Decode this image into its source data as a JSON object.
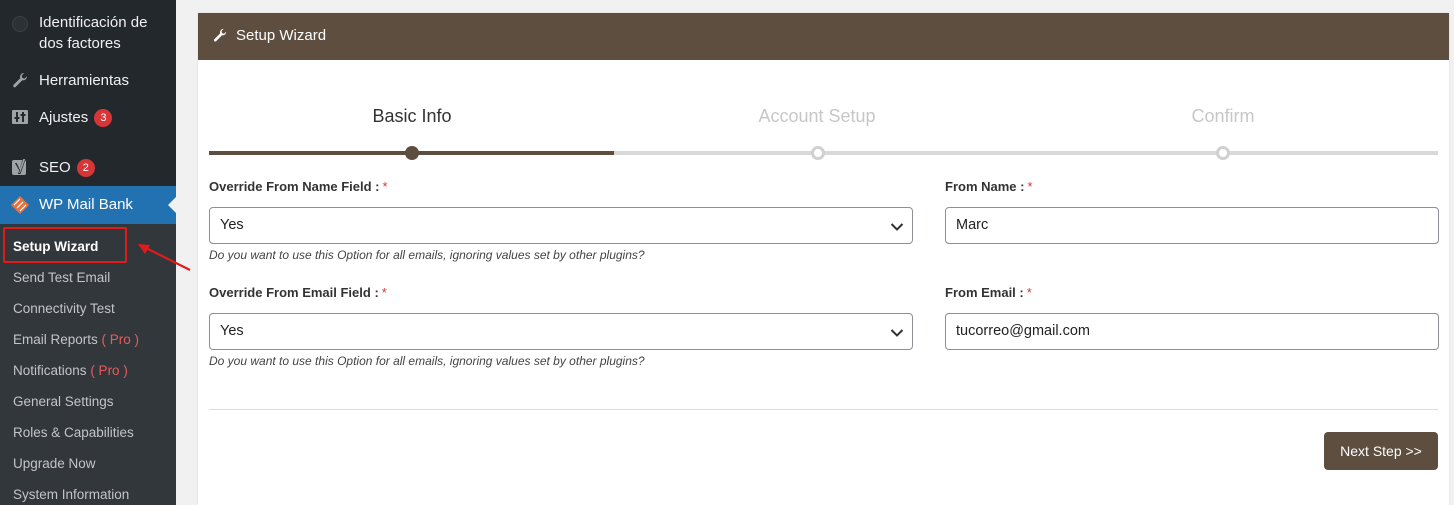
{
  "sidebar": {
    "items": [
      {
        "label_line1": "Identificación de",
        "label_line2": "dos factores",
        "icon": "two-factor-icon"
      },
      {
        "label": "Herramientas",
        "icon": "wrench-icon"
      },
      {
        "label": "Ajustes",
        "badge": "3",
        "icon": "settings-sliders-icon"
      },
      {
        "label": "SEO",
        "badge": "2",
        "icon": "yoast-seo-icon"
      },
      {
        "label": "WP Mail Bank",
        "icon": "mail-bank-icon",
        "active": true
      }
    ],
    "submenu": [
      {
        "label": "Setup Wizard",
        "active": true
      },
      {
        "label": "Send Test Email"
      },
      {
        "label": "Connectivity Test"
      },
      {
        "label": "Email Reports",
        "pro": "( Pro )"
      },
      {
        "label": "Notifications",
        "pro": "( Pro )"
      },
      {
        "label": "General Settings"
      },
      {
        "label": "Roles & Capabilities"
      },
      {
        "label": "Upgrade Now"
      },
      {
        "label": "System Information"
      }
    ]
  },
  "panel": {
    "title": "Setup Wizard",
    "header_icon": "wrench-icon",
    "header_color": "#5d4e3f"
  },
  "steps": [
    {
      "label": "Basic Info",
      "state": "active"
    },
    {
      "label": "Account Setup",
      "state": "pending"
    },
    {
      "label": "Confirm",
      "state": "pending"
    }
  ],
  "form": {
    "override_name": {
      "label": "Override From Name Field :",
      "required_mark": "*",
      "value": "Yes",
      "help": "Do you want to use this Option for all emails, ignoring values set by other plugins?"
    },
    "from_name": {
      "label": "From Name :",
      "required_mark": "*",
      "value": "Marc"
    },
    "override_email": {
      "label": "Override From Email Field :",
      "required_mark": "*",
      "value": "Yes",
      "help": "Do you want to use this Option for all emails, ignoring values set by other plugins?"
    },
    "from_email": {
      "label": "From Email :",
      "required_mark": "*",
      "value": "tucorreo@gmail.com"
    }
  },
  "actions": {
    "next_label": "Next Step >>"
  },
  "colors": {
    "accent": "#5d4e3f",
    "sidebar_bg": "#23282d",
    "submenu_bg": "#32373c",
    "active_menu": "#2271b1",
    "badge": "#d63638",
    "annotation": "#e01b1b"
  }
}
